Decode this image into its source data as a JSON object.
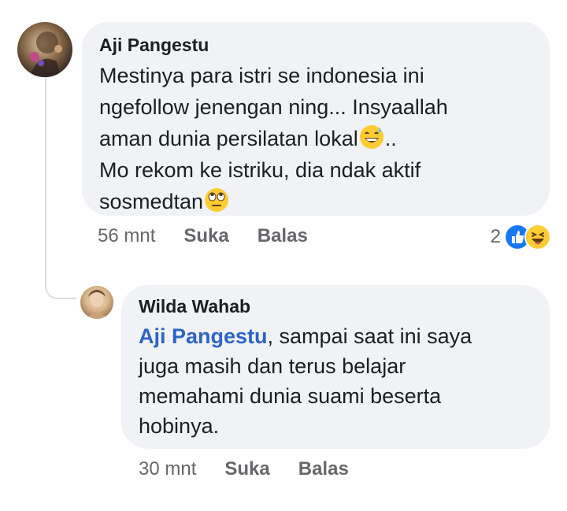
{
  "comments": [
    {
      "author": "Aji Pangestu",
      "text_lines": [
        "Mestinya para istri se indonesia ini\nngefollow jenengan ning... Insyaallah\naman dunia persilatan lokal",
        "..\nMo rekom ke istriku, dia ndak aktif\nsosmedtan"
      ],
      "time": "56 mnt",
      "like_label": "Suka",
      "reply_label": "Balas",
      "reaction_count": "2",
      "reaction_icons": [
        "like-icon",
        "haha-icon"
      ],
      "emojis": [
        "grinning-sweat-emoji",
        "rolling-eyes-emoji"
      ]
    },
    {
      "author": "Wilda Wahab",
      "mention": "Aji Pangestu",
      "text": ", sampai saat ini saya\njuga masih dan terus belajar\nmemahami dunia suami beserta\nhobinya.",
      "time": "30 mnt",
      "like_label": "Suka",
      "reply_label": "Balas"
    }
  ],
  "colors": {
    "bubble": "#f0f2f5",
    "mention": "#2c64c6",
    "meta": "#65676b",
    "like_blue": "#1877f2"
  }
}
